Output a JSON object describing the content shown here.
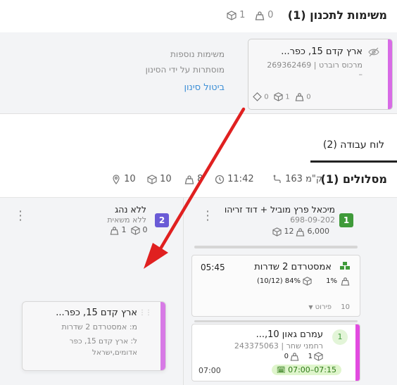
{
  "planning": {
    "title": "משימות לתכנון (1)",
    "packages": "0",
    "boxes": "1",
    "more_tasks_line1": "משימות נוספות",
    "more_tasks_line2": "מוסתרות על ידי הסינון",
    "cancel_filter": "ביטול סינון",
    "card": {
      "address": "ארץ קדם 15, כפר...",
      "customer": "מרכוס רוברט | 269362469",
      "dash": "–",
      "weight": "0",
      "boxes": "1",
      "diamonds": "0",
      "accent_color": "#d86be6"
    }
  },
  "tabs": {
    "work_board": "לוח עבודה (2)"
  },
  "routes": {
    "title": "מסלולים (1)",
    "distance": "163 ק\"מ",
    "duration": "11:42",
    "weight": "8",
    "boxes": "10",
    "stops": "10"
  },
  "driver1": {
    "badge": "1",
    "badge_color": "#3f9a3a",
    "name": "מיכאל פרץ מוביל + דוד זריהו",
    "phone": "698-09-202",
    "weight": "6,000",
    "boxes": "12",
    "route": {
      "name": "אמסטרדם 2 שדרות",
      "time": "05:45",
      "capacity": "(10/12) 84%",
      "weight_pct": "1%",
      "details_label": "פירוט",
      "details_count": "10"
    },
    "stop": {
      "number": "1",
      "address": "עמרם גאון 10,...",
      "customer": "רחמני שחר | 243375063",
      "boxes": "1",
      "weight": "0",
      "time_window": "07:00–07:15",
      "eta": "07:00"
    }
  },
  "driver2": {
    "badge": "2",
    "badge_color": "#6a5bd6",
    "name": "ללא נהג",
    "vehicle": "ללא משאית",
    "boxes": "1",
    "weight": "0"
  },
  "dragged_card": {
    "address": "ארץ קדם 15, כפר...",
    "from": "מ: אמסטרדם 2 שדרות",
    "to_line1": "ל: ארץ קדם 15, כפר",
    "to_line2": "אדומים,ישראל",
    "accent_color": "#d77ae6"
  }
}
